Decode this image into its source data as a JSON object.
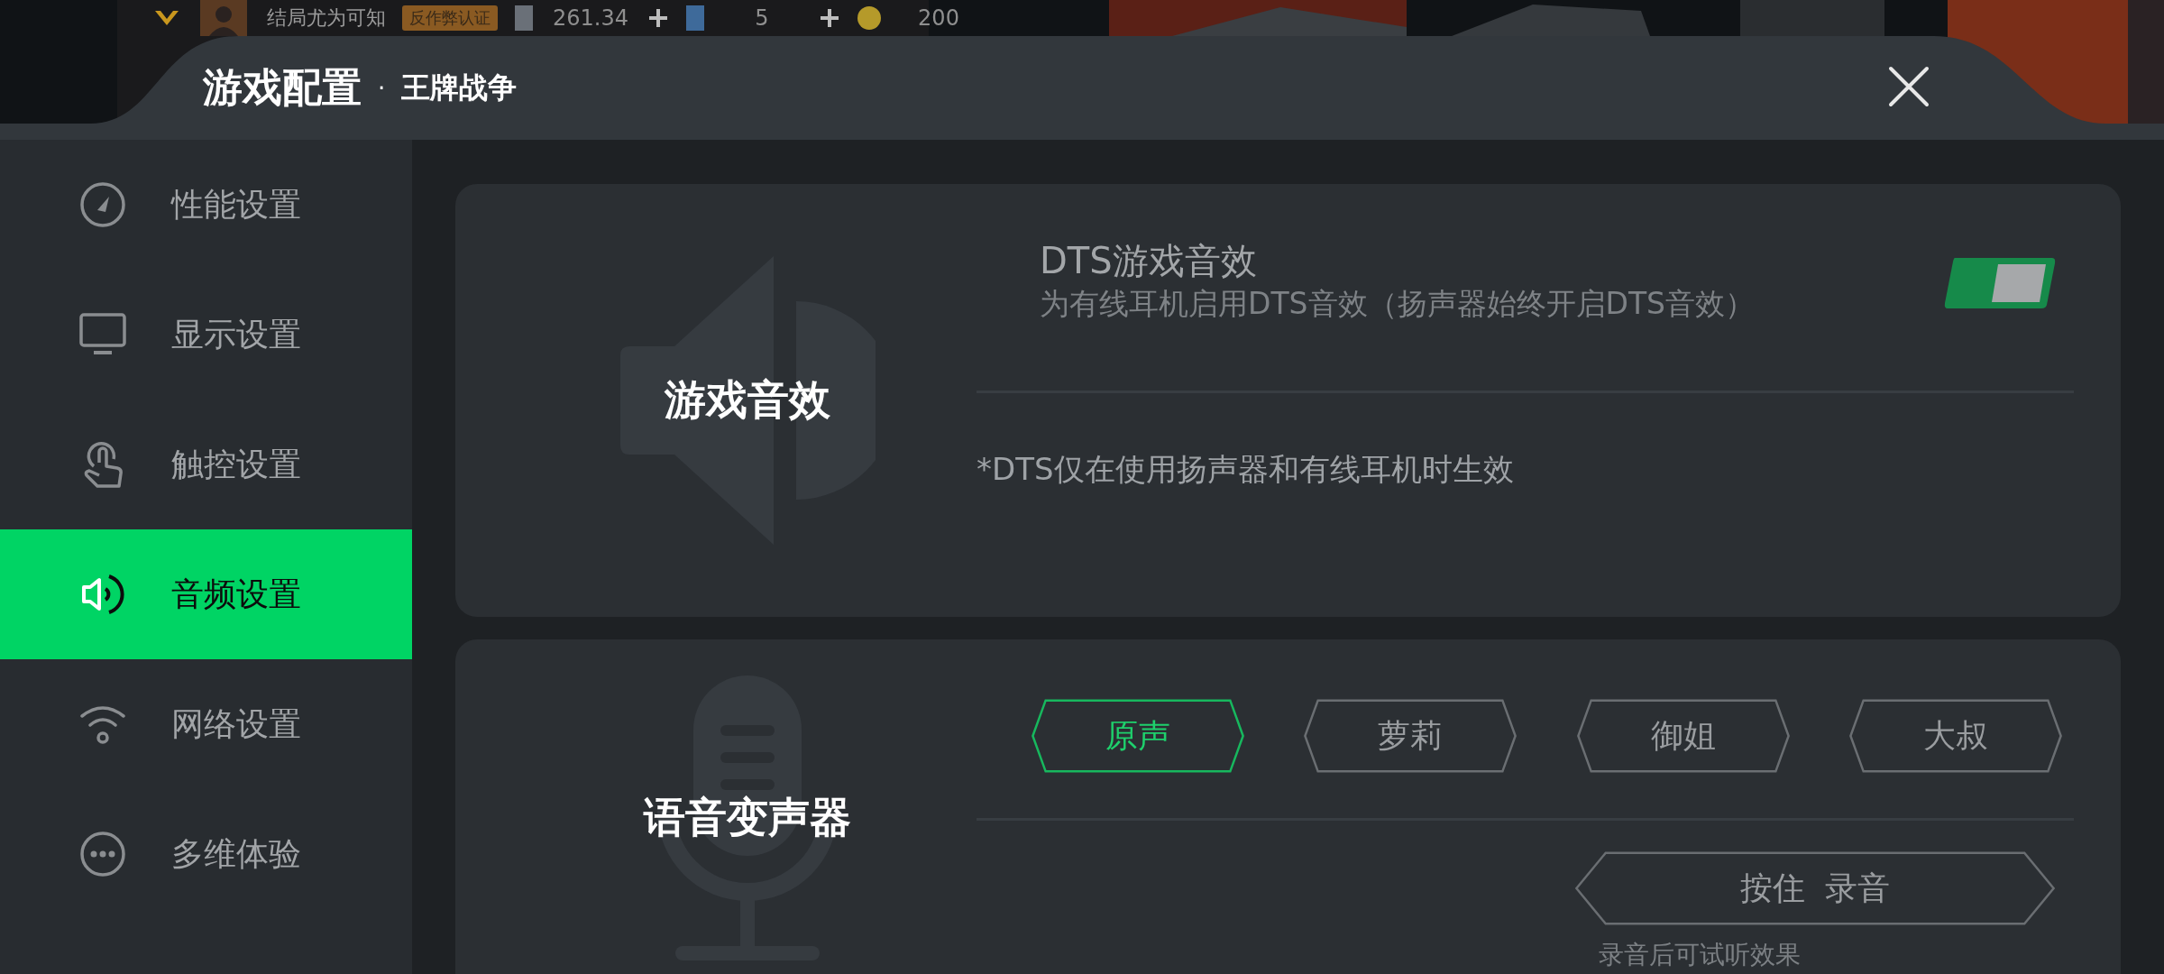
{
  "background_hud": {
    "player_name": "结局尤为可知",
    "badge": "反作弊认证",
    "currency_1": "261.34",
    "currency_2": "5",
    "currency_3": "200"
  },
  "header": {
    "title": "游戏配置",
    "separator": "·",
    "game": "王牌战争"
  },
  "sidebar": {
    "items": [
      {
        "label": "性能设置",
        "kind": "gauge",
        "selected": false
      },
      {
        "label": "显示设置",
        "kind": "monitor",
        "selected": false
      },
      {
        "label": "触控设置",
        "kind": "touch",
        "selected": false
      },
      {
        "label": "音频设置",
        "kind": "speaker",
        "selected": true
      },
      {
        "label": "网络设置",
        "kind": "wifi",
        "selected": false
      },
      {
        "label": "多维体验",
        "kind": "more",
        "selected": false
      }
    ]
  },
  "sound_card": {
    "title": "游戏音效",
    "dts": {
      "title": "DTS游戏音效",
      "description": "为有线耳机启用DTS音效（扬声器始终开启DTS音效）",
      "on": true
    },
    "note": "*DTS仅在使用扬声器和有线耳机时生效"
  },
  "voice_card": {
    "title": "语音变声器",
    "voices": [
      {
        "label": "原声",
        "selected": true
      },
      {
        "label": "萝莉",
        "selected": false
      },
      {
        "label": "御姐",
        "selected": false
      },
      {
        "label": "大叔",
        "selected": false
      }
    ],
    "record_button": "按住  录音",
    "record_hint": "录音后可试听效果"
  }
}
